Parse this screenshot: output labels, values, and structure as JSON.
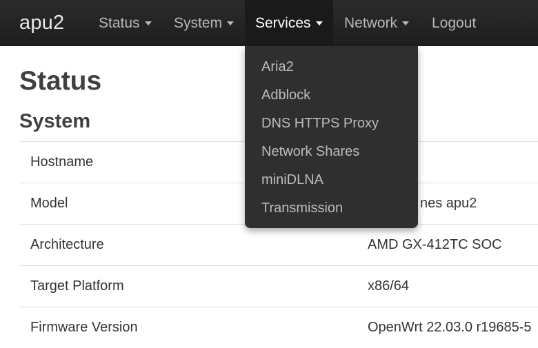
{
  "navbar": {
    "brand": "apu2",
    "items": [
      {
        "label": "Status",
        "dropdown": true
      },
      {
        "label": "System",
        "dropdown": true
      },
      {
        "label": "Services",
        "dropdown": true,
        "active": true
      },
      {
        "label": "Network",
        "dropdown": true
      },
      {
        "label": "Logout",
        "dropdown": false
      }
    ]
  },
  "services_menu": {
    "items": [
      "Aria2",
      "Adblock",
      "DNS HTTPS Proxy",
      "Network Shares",
      "miniDLNA",
      "Transmission"
    ]
  },
  "page": {
    "title": "Status",
    "section": "System",
    "rows": [
      {
        "label": "Hostname",
        "value": ""
      },
      {
        "label": "Model",
        "value": "nes apu2"
      },
      {
        "label": "Architecture",
        "value": "AMD GX-412TC SOC"
      },
      {
        "label": "Target Platform",
        "value": "x86/64"
      },
      {
        "label": "Firmware Version",
        "value": "OpenWrt 22.03.0 r19685-5"
      }
    ]
  },
  "colors": {
    "navbar_bg": "#222222",
    "active_bg": "#1a1a1a",
    "dropdown_bg": "#2f2f2f"
  }
}
